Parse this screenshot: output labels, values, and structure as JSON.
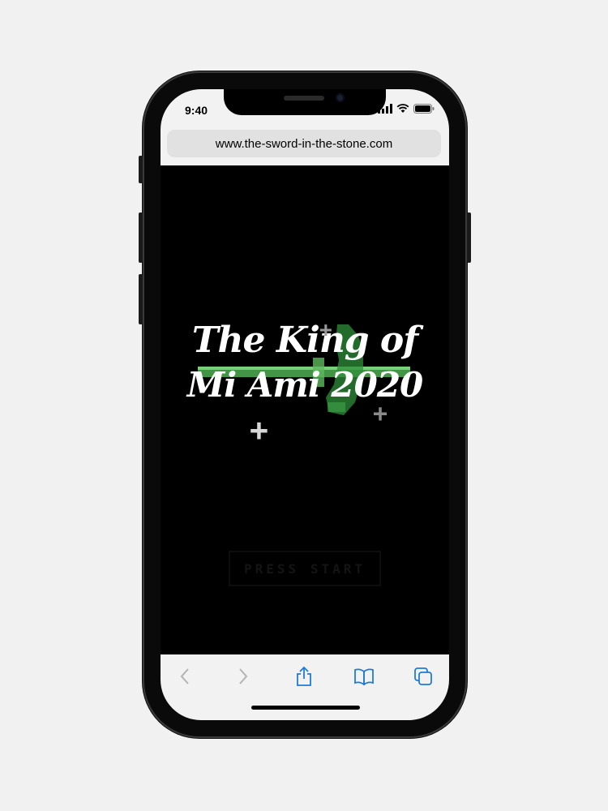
{
  "status_bar": {
    "time": "9:40",
    "signal_icon": "cellular-signal-icon",
    "wifi_icon": "wifi-icon",
    "battery_icon": "battery-icon"
  },
  "browser": {
    "url": "www.the-sword-in-the-stone.com"
  },
  "game": {
    "title_line1": "The King of",
    "title_line2": "Mi Ami 2020",
    "start_label": "PRESS START",
    "sword_color": "#4caf50",
    "accent_color": "#3e9b48"
  },
  "toolbar": {
    "back_icon": "chevron-left-icon",
    "forward_icon": "chevron-right-icon",
    "share_icon": "share-icon",
    "bookmarks_icon": "book-icon",
    "tabs_icon": "tabs-icon",
    "icon_color": "#1f7bd6",
    "disabled_color": "#b3b3b3"
  }
}
